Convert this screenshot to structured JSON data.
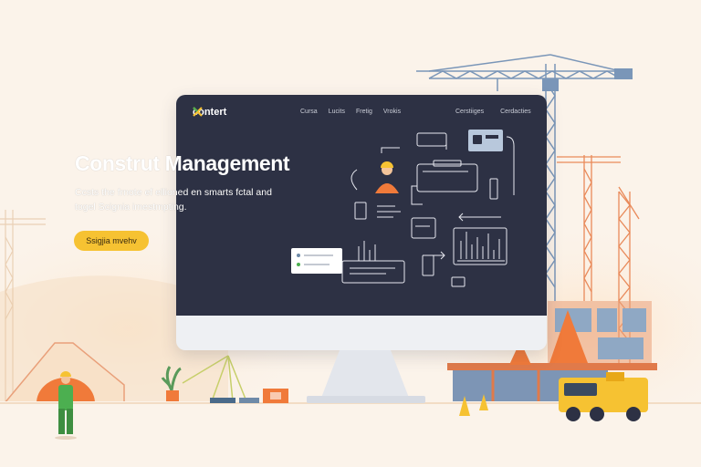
{
  "header": {
    "logo_text": "contert",
    "nav_links": [
      "Cursa",
      "Lucits",
      "Fretig",
      "Vrokis"
    ],
    "nav_right": [
      "Cerstiiges",
      "Cerdacties"
    ]
  },
  "hero": {
    "title": "Construt Management",
    "subtitle": "Ccsts the frnote ef ellioned en smarts fctal and togel Scignia imestmpting.",
    "cta_label": "Ssigjia mvehv"
  },
  "colors": {
    "screen_bg": "#2d3144",
    "accent_yellow": "#f6c232",
    "accent_orange": "#f07a3a",
    "crane_blue": "#7a96b8",
    "background": "#fbf3ea"
  },
  "icons": [
    "worker-avatar-icon",
    "crane-icon",
    "truck-icon",
    "hardhat-icon",
    "cone-icon",
    "plant-icon"
  ]
}
